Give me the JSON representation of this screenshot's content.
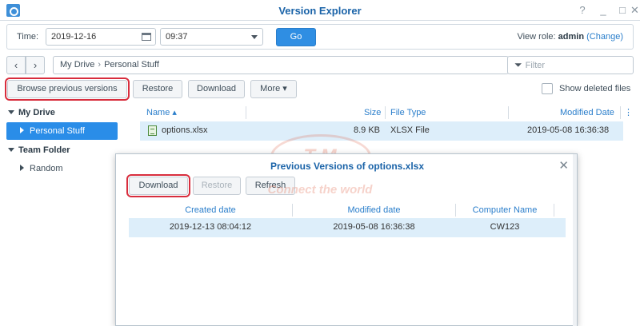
{
  "window": {
    "title": "Version Explorer",
    "controls": [
      "?",
      "_",
      "□",
      "✕"
    ]
  },
  "timebar": {
    "time_label": "Time:",
    "date_value": "2019-12-16",
    "time_value": "09:37",
    "go_label": "Go",
    "view_role_prefix": "View role:",
    "view_role": "admin",
    "change_open": "(",
    "change_label": "Change",
    "change_close": ")"
  },
  "nav": {
    "back": "‹",
    "forward": "›",
    "path": [
      "My Drive",
      "Personal Stuff"
    ],
    "path_sep": "›",
    "filter_placeholder": "Filter"
  },
  "toolbar": {
    "browse_label": "Browse previous versions",
    "restore_label": "Restore",
    "download_label": "Download",
    "more_label": "More ▾",
    "show_deleted_label": "Show deleted files"
  },
  "sidebar": {
    "my_drive": "My Drive",
    "personal_stuff": "Personal Stuff",
    "team_folder": "Team Folder",
    "random": "Random"
  },
  "file_list": {
    "columns": {
      "name": "Name ▴",
      "size": "Size",
      "type": "File Type",
      "modified": "Modified Date",
      "more": "⋮"
    },
    "rows": [
      {
        "name": "options.xlsx",
        "size": "8.9 KB",
        "type": "XLSX File",
        "modified": "2019-05-08 16:36:38"
      }
    ]
  },
  "watermark": {
    "logo": "T  M",
    "tagline": "Connect the world"
  },
  "dialog": {
    "title": "Previous Versions of options.xlsx",
    "close": "✕",
    "download_label": "Download",
    "restore_label": "Restore",
    "refresh_label": "Refresh",
    "columns": {
      "created": "Created date",
      "modified": "Modified date",
      "computer": "Computer Name"
    },
    "rows": [
      {
        "created": "2019-12-13 08:04:12",
        "modified": "2019-05-08 16:36:38",
        "computer": "CW123"
      }
    ]
  },
  "colors": {
    "accent": "#2a8de8",
    "title": "#1a63a8",
    "highlight_outline": "#d82d3d",
    "row_selected": "#ddeefa"
  }
}
